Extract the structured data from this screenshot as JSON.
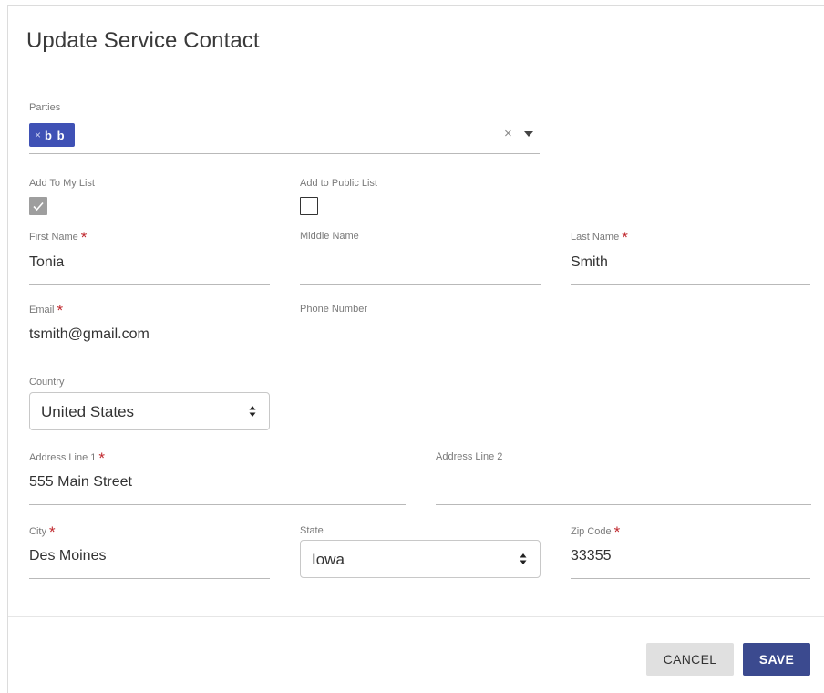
{
  "dialog": {
    "title": "Update Service Contact"
  },
  "parties": {
    "label": "Parties",
    "chip_remove": "×",
    "chip_label": "b b",
    "clear": "×",
    "dropdown_icon": "caret-down-icon"
  },
  "checkboxes": {
    "my_list": {
      "label": "Add To My List",
      "checked": true
    },
    "public_list": {
      "label": "Add to Public List",
      "checked": false
    }
  },
  "fields": {
    "first_name": {
      "label": "First Name",
      "value": "Tonia",
      "required": true
    },
    "middle_name": {
      "label": "Middle Name",
      "value": ""
    },
    "last_name": {
      "label": "Last Name",
      "value": "Smith",
      "required": true
    },
    "email": {
      "label": "Email",
      "value": "tsmith@gmail.com",
      "required": true
    },
    "phone": {
      "label": "Phone Number",
      "value": ""
    },
    "country": {
      "label": "Country",
      "value": "United States"
    },
    "address1": {
      "label": "Address Line 1",
      "value": "555 Main Street",
      "required": true
    },
    "address2": {
      "label": "Address Line 2",
      "value": ""
    },
    "city": {
      "label": "City",
      "value": "Des Moines",
      "required": true
    },
    "state": {
      "label": "State",
      "value": "Iowa"
    },
    "zip": {
      "label": "Zip Code",
      "value": "33355",
      "required": true
    }
  },
  "required_marker": "*",
  "buttons": {
    "cancel": "CANCEL",
    "save": "SAVE"
  },
  "colors": {
    "accent": "#3f51b5",
    "save_button": "#3b4a8f",
    "required": "#c0272d"
  }
}
